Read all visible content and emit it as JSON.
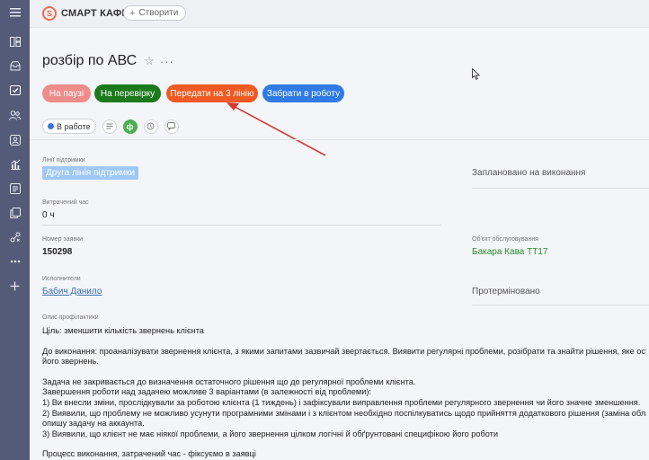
{
  "sidebar": {
    "items": [
      {
        "icon": "menu-icon"
      },
      {
        "icon": "columns-icon"
      },
      {
        "icon": "inbox-icon"
      },
      {
        "icon": "task-icon"
      },
      {
        "icon": "people-icon"
      },
      {
        "icon": "contact-icon"
      },
      {
        "icon": "analytics-icon"
      },
      {
        "icon": "document-icon"
      },
      {
        "icon": "copy-icon"
      },
      {
        "icon": "integrations-icon"
      },
      {
        "icon": "more-icon"
      },
      {
        "icon": "add-icon"
      }
    ]
  },
  "topbar": {
    "logo_mark": "S",
    "logo_text": "СМАРТ КАФЕ",
    "create_label": "Створити"
  },
  "task": {
    "title": "розбір по АВС",
    "actions": {
      "pause": "На паузі",
      "review": "На перевірку",
      "transfer": "Передати на 3 лінію",
      "take": "Забрати в роботу"
    },
    "status": "В работе"
  },
  "fields": {
    "support_line_label": "Лінії підтримки",
    "support_line_value": "Друга лінія підтримки",
    "planned_label": "Заплановано на виконання",
    "time_spent_label": "Витрачений час",
    "time_spent_value": "0 ч",
    "request_number_label": "Номер заявки",
    "request_number_value": "150298",
    "service_object_label": "Об'єкт обслуговування",
    "service_object_value": "Бакара Кава ТТ17",
    "assignees_label": "Исполнители",
    "assignee_value": "Бабич Данило",
    "overdue_label": "Протерміновано",
    "description_label": "Опис профілактики"
  },
  "description": {
    "goal": "Ціль: зменшити кількість звернень клієнта",
    "todo": "До виконання: проаналізувати звернення клієнта, з якими запитами зазвичай звертається. Виявити регулярні проблеми, розібрати та знайти рішення, яке остаточно вирішить",
    "todo_cont": "його звернень.",
    "not_closed": "Задача не закривається до визначення остаточного рішення що до регулярної проблеми клієнта.",
    "completion": "Завершення роботи над задачею можливе 3 варіантами (в залежності від проблеми):",
    "opt1": "1) Ви внесли зміни, прослідкували за роботою клієнта (1 тиждень) і зафіксували виправлення проблеми регулярного звернення чи його значне зменшення.",
    "opt2": "2) Виявили, що проблему не можливо усунути програмними змінами і з клієнтом необхідно поспілкуватись щодо прийняття додаткового рішення (заміна обладнання...",
    "opt2_cont": "опишу задачу на аккаунта.",
    "opt3": "3) Виявили, що клієнт не має ніякої проблеми, а його звернення цілком логічні й обґрунтовані специфікою його роботи",
    "process": "Процесс виконання, затрачений час - фіксуємо в заявці"
  }
}
